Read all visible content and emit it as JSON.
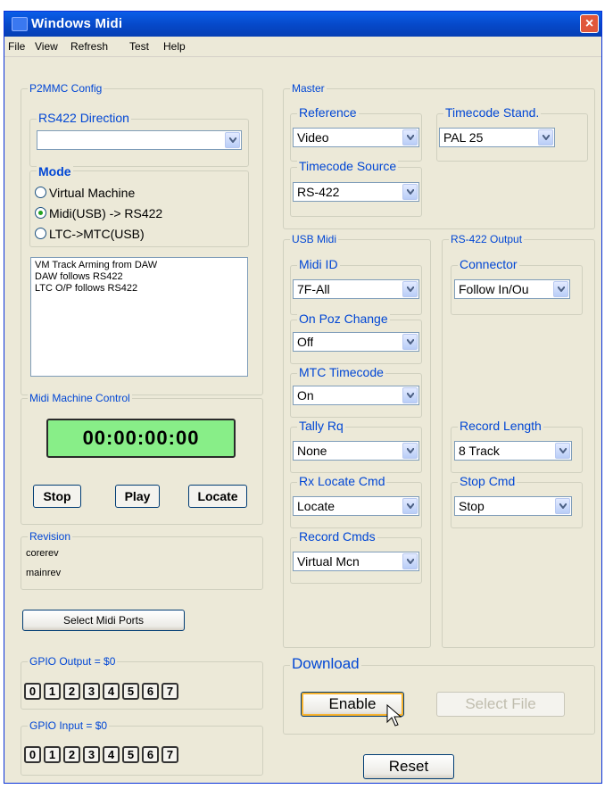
{
  "window": {
    "title": "Windows Midi",
    "close_glyph": "×"
  },
  "menu": [
    "File",
    "View",
    "Refresh",
    "Test",
    "Help"
  ],
  "p2mmc": {
    "label": "P2MMC Config",
    "rs422_direction": {
      "label": "RS422 Direction",
      "value": ""
    },
    "mode": {
      "label": "Mode",
      "options": [
        "Virtual Machine",
        "Midi(USB) -> RS422",
        "LTC->MTC(USB)"
      ],
      "selected": "Midi(USB) -> RS422"
    },
    "status_lines": [
      "VM Track Arming from DAW",
      "DAW follows RS422",
      "LTC O/P follows RS422"
    ]
  },
  "mmc": {
    "label": "Midi Machine Control",
    "timecode": "00:00:00:00",
    "stop": "Stop",
    "play": "Play",
    "locate": "Locate"
  },
  "revision": {
    "label": "Revision",
    "corerev": "corerev",
    "mainrev": "mainrev"
  },
  "select_midi_ports": "Select Midi Ports",
  "gpio_output": {
    "label": "GPIO Output = $0",
    "bits": [
      "0",
      "1",
      "2",
      "3",
      "4",
      "5",
      "6",
      "7"
    ]
  },
  "gpio_input": {
    "label": "GPIO Input = $0",
    "bits": [
      "0",
      "1",
      "2",
      "3",
      "4",
      "5",
      "6",
      "7"
    ]
  },
  "master": {
    "label": "Master",
    "reference": {
      "label": "Reference",
      "value": "Video"
    },
    "timecode_standard": {
      "label": "Timecode Stand.",
      "value": "PAL 25"
    },
    "timecode_source": {
      "label": "Timecode Source",
      "value": "RS-422"
    }
  },
  "usb_midi": {
    "label": "USB Midi",
    "midi_id": {
      "label": "Midi ID",
      "value": "7F-All"
    },
    "on_poz_change": {
      "label": "On Poz Change",
      "value": "Off"
    },
    "mtc_timecode": {
      "label": "MTC Timecode",
      "value": "On"
    },
    "tally_rq": {
      "label": "Tally Rq",
      "value": "None"
    },
    "rx_locate_cmd": {
      "label": "Rx Locate Cmd",
      "value": "Locate"
    },
    "record_cmds": {
      "label": "Record Cmds",
      "value": "Virtual Mcn"
    }
  },
  "rs422_output": {
    "label": "RS-422 Output",
    "connector": {
      "label": "Connector",
      "value": "Follow In/Ou"
    },
    "record_length": {
      "label": "Record Length",
      "value": "8 Track"
    },
    "stop_cmd": {
      "label": "Stop Cmd",
      "value": "Stop"
    }
  },
  "download": {
    "label": "Download",
    "enable": "Enable",
    "select_file": "Select File"
  },
  "reset": "Reset",
  "colors": {
    "titlebar": "#0648c8",
    "group_label": "#0046d5",
    "timecode_bg": "#88ee88",
    "face": "#ece9d8"
  }
}
